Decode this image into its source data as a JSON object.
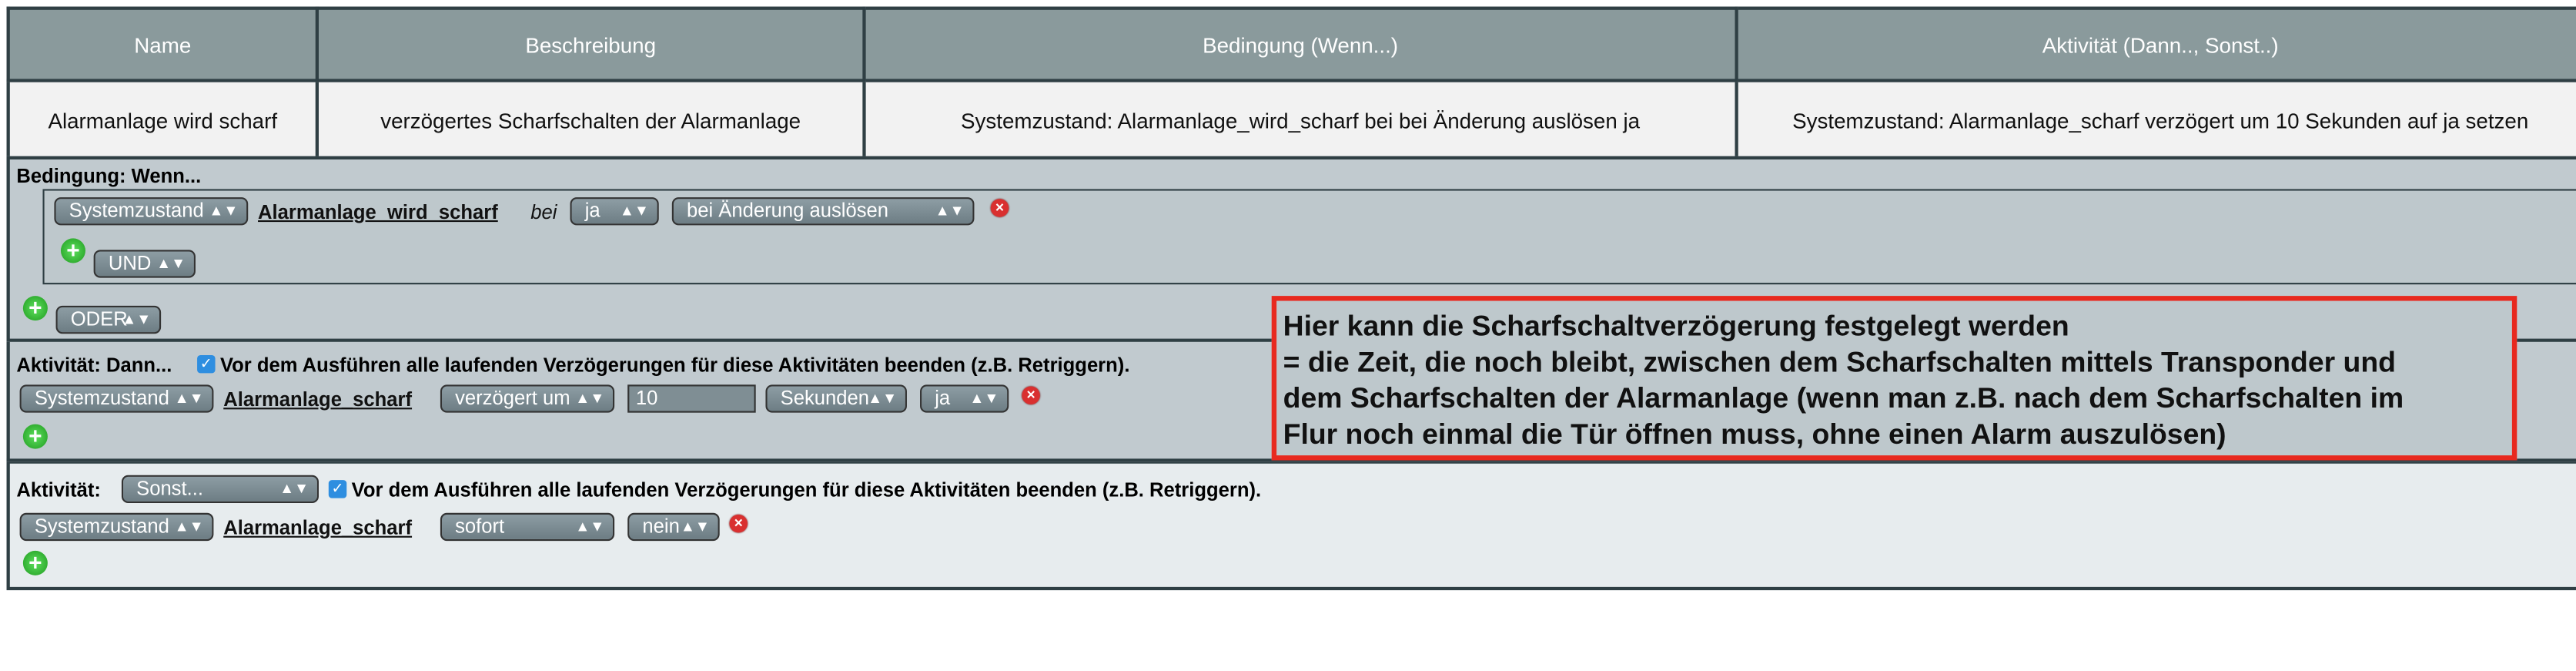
{
  "table": {
    "headers": [
      "Name",
      "Beschreibung",
      "Bedingung (Wenn...)",
      "Aktivität (Dann.., Sonst..)"
    ],
    "row": {
      "name": "Alarmanlage wird scharf",
      "beschreibung": "verzögertes Scharfschalten der Alarmanlage",
      "bedingung": "Systemzustand: Alarmanlage_wird_scharf bei bei Änderung auslösen ja",
      "aktivitaet": "Systemzustand: Alarmanlage_scharf verzögert um 10 Sekunden auf ja setzen"
    }
  },
  "condition": {
    "label": "Bedingung: Wenn...",
    "source_select": "Systemzustand",
    "variable_link": "Alarmanlage_wird_scharf",
    "bei": "bei",
    "value_select": "ja",
    "trigger_select": "bei Änderung auslösen",
    "und_select": "UND",
    "oder_select": "ODER"
  },
  "then": {
    "label": "Aktivität: Dann...",
    "checkbox_label": "Vor dem Ausführen alle laufenden Verzögerungen für diese Aktivitäten beenden (z.B. Retriggern).",
    "source_select": "Systemzustand",
    "variable_link": "Alarmanlage_scharf",
    "mode_select": "verzögert um",
    "delay_value": "10",
    "unit_select": "Sekunden",
    "value_select": "ja"
  },
  "else": {
    "label": "Aktivität:",
    "branch_select": "Sonst...",
    "checkbox_label": "Vor dem Ausführen alle laufenden Verzögerungen für diese Aktivitäten beenden (z.B. Retriggern).",
    "source_select": "Systemzustand",
    "variable_link": "Alarmanlage_scharf",
    "mode_select": "sofort",
    "value_select": "nein"
  },
  "annotation": {
    "line1": "Hier kann die Scharfschaltverzögerung festgelegt werden",
    "line2": "= die Zeit, die noch bleibt, zwischen dem Scharfschalten mittels Transponder und",
    "line3": "dem Scharfschalten der Alarmanlage (wenn man z.B. nach dem Scharfschalten im",
    "line4": "Flur noch einmal die Tür öffnen muss, ohne einen Alarm auszulösen)",
    "border_color": "#e8291f"
  },
  "colors": {
    "header_bg": "#8a9a9c",
    "panel_bg": "#c1cacf",
    "else_bg": "#e7ecee"
  }
}
